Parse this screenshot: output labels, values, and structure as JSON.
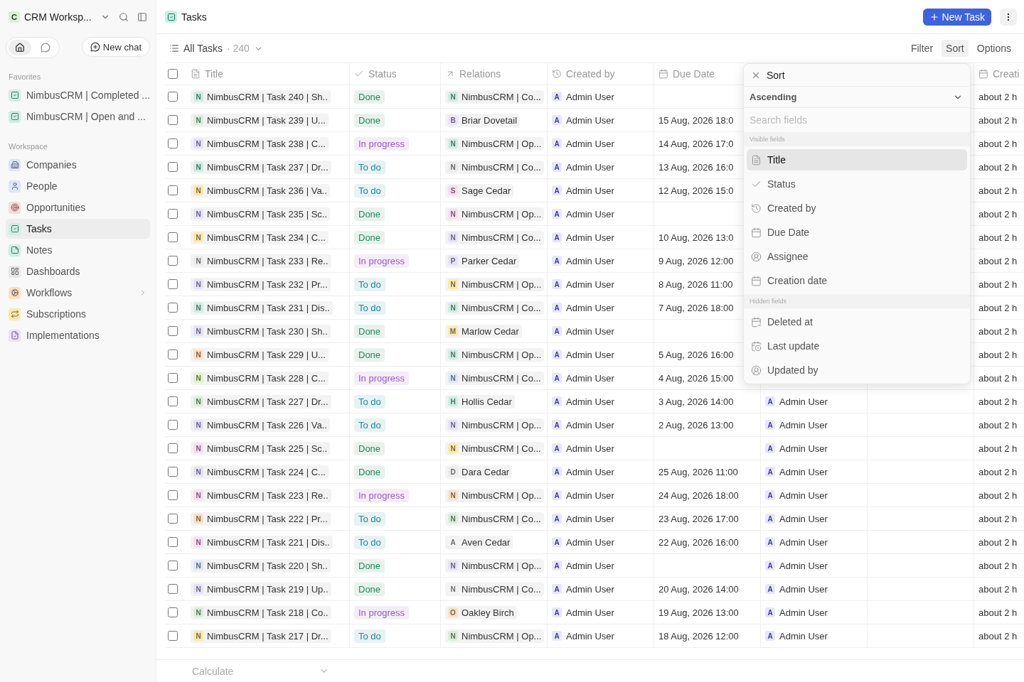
{
  "sidebar": {
    "workspace": {
      "initial": "C",
      "name": "CRM Worksp..."
    },
    "modes": [
      {
        "kind": "home",
        "selected": true
      },
      {
        "kind": "chat",
        "selected": false
      }
    ],
    "new_chat": "New chat",
    "favorites_label": "Favorites",
    "favorites": [
      {
        "label": "NimbusCRM | Completed ...",
        "kind": "check",
        "color": "#c9f0e4"
      },
      {
        "label": "NimbusCRM | Open and ...",
        "kind": "check",
        "color": "#c9f0e4"
      }
    ],
    "workspace_label": "Workspace",
    "items": [
      {
        "label": "Companies",
        "kind": "building",
        "color": "#dde5fb",
        "selected": false,
        "expandable": false
      },
      {
        "label": "People",
        "kind": "person",
        "color": "#dde5fb",
        "selected": false,
        "expandable": false
      },
      {
        "label": "Opportunities",
        "kind": "target",
        "color": "#fbd9d9",
        "selected": false,
        "expandable": false
      },
      {
        "label": "Tasks",
        "kind": "check",
        "color": "#c9f0e4",
        "selected": true,
        "expandable": false
      },
      {
        "label": "Notes",
        "kind": "note",
        "color": "#c9f0e4",
        "selected": false,
        "expandable": false
      },
      {
        "label": "Dashboards",
        "kind": "grid",
        "color": "#e6e6e6",
        "selected": false,
        "expandable": false
      },
      {
        "label": "Workflows",
        "kind": "gear",
        "color": "#fde0c2",
        "selected": false,
        "expandable": true
      },
      {
        "label": "Subscriptions",
        "kind": "repeat",
        "color": "#fbeaa6",
        "selected": false,
        "expandable": false
      },
      {
        "label": "Implementations",
        "kind": "form",
        "color": "#ece0fb",
        "selected": false,
        "expandable": false
      }
    ]
  },
  "header": {
    "title": "Tasks",
    "new_button": "New Task"
  },
  "view": {
    "name": "All Tasks",
    "count": "· 240",
    "actions": [
      {
        "label": "Filter",
        "selected": false
      },
      {
        "label": "Sort",
        "selected": true
      },
      {
        "label": "Options",
        "selected": false
      }
    ]
  },
  "table": {
    "all_checked": false,
    "columns": [
      {
        "label": "Title",
        "kind": "text"
      },
      {
        "label": "Status",
        "kind": "select"
      },
      {
        "label": "Relations",
        "kind": "relation"
      },
      {
        "label": "Created by",
        "kind": "source"
      },
      {
        "label": "Due Date",
        "kind": "date"
      },
      {
        "label": "Creati",
        "kind": "date"
      }
    ],
    "rows": [
      {
        "checked": false,
        "title": {
          "initial": "N",
          "color": "#c9f0e4",
          "text": "NimbusCRM | Task 240 | Sh.."
        },
        "status": {
          "label": "Done",
          "color": "#23895f"
        },
        "relation": {
          "initial": "N",
          "color": "#c9f0e4",
          "text": "NimbusCRM | Co..."
        },
        "created_by": {
          "initial": "A",
          "name": "Admin User"
        },
        "due": "",
        "creation": "about 2 h"
      },
      {
        "checked": false,
        "title": {
          "initial": "N",
          "color": "#d6f0d8",
          "text": "NimbusCRM | Task 239 | U..."
        },
        "status": {
          "label": "Done",
          "color": "#23895f"
        },
        "relation": {
          "initial": "B",
          "color": "#ece4fb",
          "text": "Briar Dovetail"
        },
        "created_by": {
          "initial": "A",
          "name": "Admin User"
        },
        "due": "15 Aug, 2026 18:0",
        "creation": "about 2 h"
      },
      {
        "checked": false,
        "title": {
          "initial": "N",
          "color": "#e6e2fb",
          "text": "NimbusCRM | Task 238 | C..."
        },
        "status": {
          "label": "In progress",
          "color": "#9a5cc4"
        },
        "relation": {
          "initial": "N",
          "color": "#c9f0e4",
          "text": "NimbusCRM | Op..."
        },
        "created_by": {
          "initial": "A",
          "name": "Admin User"
        },
        "due": "14 Aug, 2026 17:0",
        "creation": "about 2 h"
      },
      {
        "checked": false,
        "title": {
          "initial": "N",
          "color": "#c9f0e4",
          "text": "NimbusCRM | Task 237 | Dr..."
        },
        "status": {
          "label": "To do",
          "color": "#1f8a96"
        },
        "relation": {
          "initial": "N",
          "color": "#ececec",
          "text": "NimbusCRM | Co..."
        },
        "created_by": {
          "initial": "A",
          "name": "Admin User"
        },
        "due": "13 Aug, 2026 16:0",
        "creation": "about 2 h"
      },
      {
        "checked": false,
        "title": {
          "initial": "N",
          "color": "#fbeaa6",
          "text": "NimbusCRM | Task 236 | Va.."
        },
        "status": {
          "label": "To do",
          "color": "#1f8a96"
        },
        "relation": {
          "initial": "S",
          "color": "#fadcf0",
          "text": "Sage Cedar"
        },
        "created_by": {
          "initial": "A",
          "name": "Admin User"
        },
        "due": "12 Aug, 2026 15:0",
        "creation": "about 2 h"
      },
      {
        "checked": false,
        "title": {
          "initial": "N",
          "color": "#e6e2fb",
          "text": "NimbusCRM | Task 235 | Sc.."
        },
        "status": {
          "label": "Done",
          "color": "#23895f"
        },
        "relation": {
          "initial": "N",
          "color": "#fadcf0",
          "text": "NimbusCRM | Op..."
        },
        "created_by": {
          "initial": "A",
          "name": "Admin User"
        },
        "due": "",
        "creation": "about 2 h"
      },
      {
        "checked": false,
        "title": {
          "initial": "N",
          "color": "#fbeaa6",
          "text": "NimbusCRM | Task 234 | C..."
        },
        "status": {
          "label": "Done",
          "color": "#23895f"
        },
        "relation": {
          "initial": "N",
          "color": "#e6e2fb",
          "text": "NimbusCRM | Co..."
        },
        "created_by": {
          "initial": "A",
          "name": "Admin User"
        },
        "due": "10 Aug, 2026 13:0",
        "creation": "about 2 h"
      },
      {
        "checked": false,
        "title": {
          "initial": "N",
          "color": "#ececec",
          "text": "NimbusCRM | Task 233 | Re.."
        },
        "status": {
          "label": "In progress",
          "color": "#9a5cc4"
        },
        "relation": {
          "initial": "P",
          "color": "#e6e2fb",
          "text": "Parker Cedar"
        },
        "created_by": {
          "initial": "A",
          "name": "Admin User"
        },
        "due": "9 Aug, 2026 12:00",
        "creation": "about 2 h"
      },
      {
        "checked": false,
        "title": {
          "initial": "N",
          "color": "#e6e2fb",
          "text": "NimbusCRM | Task 232 | Pr..."
        },
        "status": {
          "label": "To do",
          "color": "#1f8a96"
        },
        "relation": {
          "initial": "N",
          "color": "#fbeaa6",
          "text": "NimbusCRM | Op..."
        },
        "created_by": {
          "initial": "A",
          "name": "Admin User"
        },
        "due": "8 Aug, 2026 11:00",
        "creation": "about 2 h"
      },
      {
        "checked": false,
        "title": {
          "initial": "N",
          "color": "#c9f0e4",
          "text": "NimbusCRM | Task 231 | Dis.."
        },
        "status": {
          "label": "To do",
          "color": "#1f8a96"
        },
        "relation": {
          "initial": "N",
          "color": "#c9f0e4",
          "text": "NimbusCRM | Co..."
        },
        "created_by": {
          "initial": "A",
          "name": "Admin User"
        },
        "due": "7 Aug, 2026 18:00",
        "creation": "about 2 h"
      },
      {
        "checked": false,
        "title": {
          "initial": "N",
          "color": "#e6e2fb",
          "text": "NimbusCRM | Task 230 | Sh.."
        },
        "status": {
          "label": "Done",
          "color": "#23895f"
        },
        "relation": {
          "initial": "M",
          "color": "#fbeaa6",
          "text": "Marlow Cedar"
        },
        "created_by": {
          "initial": "A",
          "name": "Admin User"
        },
        "due": "",
        "creation": "about 2 h"
      },
      {
        "checked": false,
        "title": {
          "initial": "N",
          "color": "#fde0c2",
          "text": "NimbusCRM | Task 229 | U..."
        },
        "status": {
          "label": "Done",
          "color": "#23895f"
        },
        "relation": {
          "initial": "N",
          "color": "#c9f0e4",
          "text": "NimbusCRM | Op..."
        },
        "created_by": {
          "initial": "A",
          "name": "Admin User"
        },
        "due": "5 Aug, 2026 16:00",
        "creation": "about 2 h"
      },
      {
        "checked": false,
        "title": {
          "initial": "N",
          "color": "#e4f2c7",
          "text": "NimbusCRM | Task 228 | C..."
        },
        "status": {
          "label": "In progress",
          "color": "#9a5cc4"
        },
        "relation": {
          "initial": "N",
          "color": "#dbe8fb",
          "text": "NimbusCRM | Co..."
        },
        "created_by": {
          "initial": "A",
          "name": "Admin User"
        },
        "due": "4 Aug, 2026 15:00",
        "creation": "about 2 h"
      },
      {
        "checked": false,
        "title": {
          "initial": "N",
          "color": "#d6f0d8",
          "text": "NimbusCRM | Task 227 | Dr..."
        },
        "status": {
          "label": "To do",
          "color": "#1f8a96"
        },
        "relation": {
          "initial": "H",
          "color": "#c9f0e4",
          "text": "Hollis Cedar"
        },
        "created_by": {
          "initial": "A",
          "name": "Admin User"
        },
        "due": "3 Aug, 2026 14:00",
        "assignee": {
          "initial": "A",
          "name": "Admin User"
        },
        "creation": "about 2 h"
      },
      {
        "checked": false,
        "title": {
          "initial": "N",
          "color": "#e6e2fb",
          "text": "NimbusCRM | Task 226 | Va.."
        },
        "status": {
          "label": "To do",
          "color": "#1f8a96"
        },
        "relation": {
          "initial": "N",
          "color": "#e6e2fb",
          "text": "NimbusCRM | Op..."
        },
        "created_by": {
          "initial": "A",
          "name": "Admin User"
        },
        "due": "2 Aug, 2026 13:00",
        "assignee": {
          "initial": "A",
          "name": "Admin User"
        },
        "creation": "about 2 h"
      },
      {
        "checked": false,
        "title": {
          "initial": "N",
          "color": "#fadcf0",
          "text": "NimbusCRM | Task 225 | Sc.."
        },
        "status": {
          "label": "Done",
          "color": "#23895f"
        },
        "relation": {
          "initial": "N",
          "color": "#fbeaa6",
          "text": "NimbusCRM | Co..."
        },
        "created_by": {
          "initial": "A",
          "name": "Admin User"
        },
        "due": "",
        "assignee": {
          "initial": "A",
          "name": "Admin User"
        },
        "creation": "about 2 h"
      },
      {
        "checked": false,
        "title": {
          "initial": "N",
          "color": "#e6e2fb",
          "text": "NimbusCRM | Task 224 | C..."
        },
        "status": {
          "label": "Done",
          "color": "#23895f"
        },
        "relation": {
          "initial": "D",
          "color": "#ececec",
          "text": "Dara Cedar"
        },
        "created_by": {
          "initial": "A",
          "name": "Admin User"
        },
        "due": "25 Aug, 2026 11:00",
        "assignee": {
          "initial": "A",
          "name": "Admin User"
        },
        "creation": "about 2 h"
      },
      {
        "checked": false,
        "title": {
          "initial": "N",
          "color": "#fadcf0",
          "text": "NimbusCRM | Task 223 | Re.."
        },
        "status": {
          "label": "In progress",
          "color": "#9a5cc4"
        },
        "relation": {
          "initial": "N",
          "color": "#fde0c2",
          "text": "NimbusCRM | Op..."
        },
        "created_by": {
          "initial": "A",
          "name": "Admin User"
        },
        "due": "24 Aug, 2026 18:00",
        "assignee": {
          "initial": "A",
          "name": "Admin User"
        },
        "creation": "about 2 h"
      },
      {
        "checked": false,
        "title": {
          "initial": "N",
          "color": "#fde0c2",
          "text": "NimbusCRM | Task 222 | Pr..."
        },
        "status": {
          "label": "To do",
          "color": "#1f8a96"
        },
        "relation": {
          "initial": "N",
          "color": "#d6f0d8",
          "text": "NimbusCRM | Co..."
        },
        "created_by": {
          "initial": "A",
          "name": "Admin User"
        },
        "due": "23 Aug, 2026 17:00",
        "assignee": {
          "initial": "A",
          "name": "Admin User"
        },
        "creation": "about 2 h"
      },
      {
        "checked": false,
        "title": {
          "initial": "N",
          "color": "#fadcf0",
          "text": "NimbusCRM | Task 221 | Dis.."
        },
        "status": {
          "label": "To do",
          "color": "#1f8a96"
        },
        "relation": {
          "initial": "A",
          "color": "#f3f3f3",
          "text": "Aven Cedar"
        },
        "created_by": {
          "initial": "A",
          "name": "Admin User"
        },
        "due": "22 Aug, 2026 16:00",
        "assignee": {
          "initial": "A",
          "name": "Admin User"
        },
        "creation": "about 2 h"
      },
      {
        "checked": false,
        "title": {
          "initial": "N",
          "color": "#dbe8fb",
          "text": "NimbusCRM | Task 220 | Sh.."
        },
        "status": {
          "label": "Done",
          "color": "#23895f"
        },
        "relation": {
          "initial": "N",
          "color": "#e6e2fb",
          "text": "NimbusCRM | Op..."
        },
        "created_by": {
          "initial": "A",
          "name": "Admin User"
        },
        "due": "",
        "assignee": {
          "initial": "A",
          "name": "Admin User"
        },
        "creation": "about 2 h"
      },
      {
        "checked": false,
        "title": {
          "initial": "N",
          "color": "#e6e2fb",
          "text": "NimbusCRM | Task 219 | Up.."
        },
        "status": {
          "label": "Done",
          "color": "#23895f"
        },
        "relation": {
          "initial": "N",
          "color": "#f3f3f3",
          "text": "NimbusCRM | Co..."
        },
        "created_by": {
          "initial": "A",
          "name": "Admin User"
        },
        "due": "20 Aug, 2026 14:00",
        "assignee": {
          "initial": "A",
          "name": "Admin User"
        },
        "creation": "about 2 h"
      },
      {
        "checked": false,
        "title": {
          "initial": "N",
          "color": "#d6f0d8",
          "text": "NimbusCRM | Task 218 | Co.."
        },
        "status": {
          "label": "In progress",
          "color": "#9a5cc4"
        },
        "relation": {
          "initial": "O",
          "color": "#fde0c2",
          "text": "Oakley Birch"
        },
        "created_by": {
          "initial": "A",
          "name": "Admin User"
        },
        "due": "19 Aug, 2026 13:00",
        "assignee": {
          "initial": "A",
          "name": "Admin User"
        },
        "creation": "about 2 h"
      },
      {
        "checked": false,
        "title": {
          "initial": "N",
          "color": "#fbeaa6",
          "text": "NimbusCRM | Task 217 | Dr..."
        },
        "status": {
          "label": "To do",
          "color": "#1f8a96"
        },
        "relation": {
          "initial": "N",
          "color": "#d6f0d8",
          "text": "NimbusCRM | Op..."
        },
        "created_by": {
          "initial": "A",
          "name": "Admin User"
        },
        "due": "18 Aug, 2026 12:00",
        "assignee": {
          "initial": "A",
          "name": "Admin User"
        },
        "creation": "about 2 h"
      }
    ],
    "footer": "Calculate"
  },
  "sort_menu": {
    "title": "Sort",
    "direction": "Ascending",
    "search": {
      "placeholder": "Search fields"
    },
    "sections": [
      {
        "label": "Visible fields",
        "fields": [
          {
            "label": "Title",
            "kind": "text",
            "selected": true
          },
          {
            "label": "Status",
            "kind": "select",
            "selected": false
          },
          {
            "label": "Created by",
            "kind": "source",
            "selected": false
          },
          {
            "label": "Due Date",
            "kind": "date",
            "selected": false
          },
          {
            "label": "Assignee",
            "kind": "person",
            "selected": false
          },
          {
            "label": "Creation date",
            "kind": "date",
            "selected": false
          }
        ]
      },
      {
        "label": "Hidden fields",
        "fields": [
          {
            "label": "Deleted at",
            "kind": "date_minus",
            "selected": false
          },
          {
            "label": "Last update",
            "kind": "date_clock",
            "selected": false
          },
          {
            "label": "Updated by",
            "kind": "person",
            "selected": false
          }
        ]
      }
    ]
  }
}
